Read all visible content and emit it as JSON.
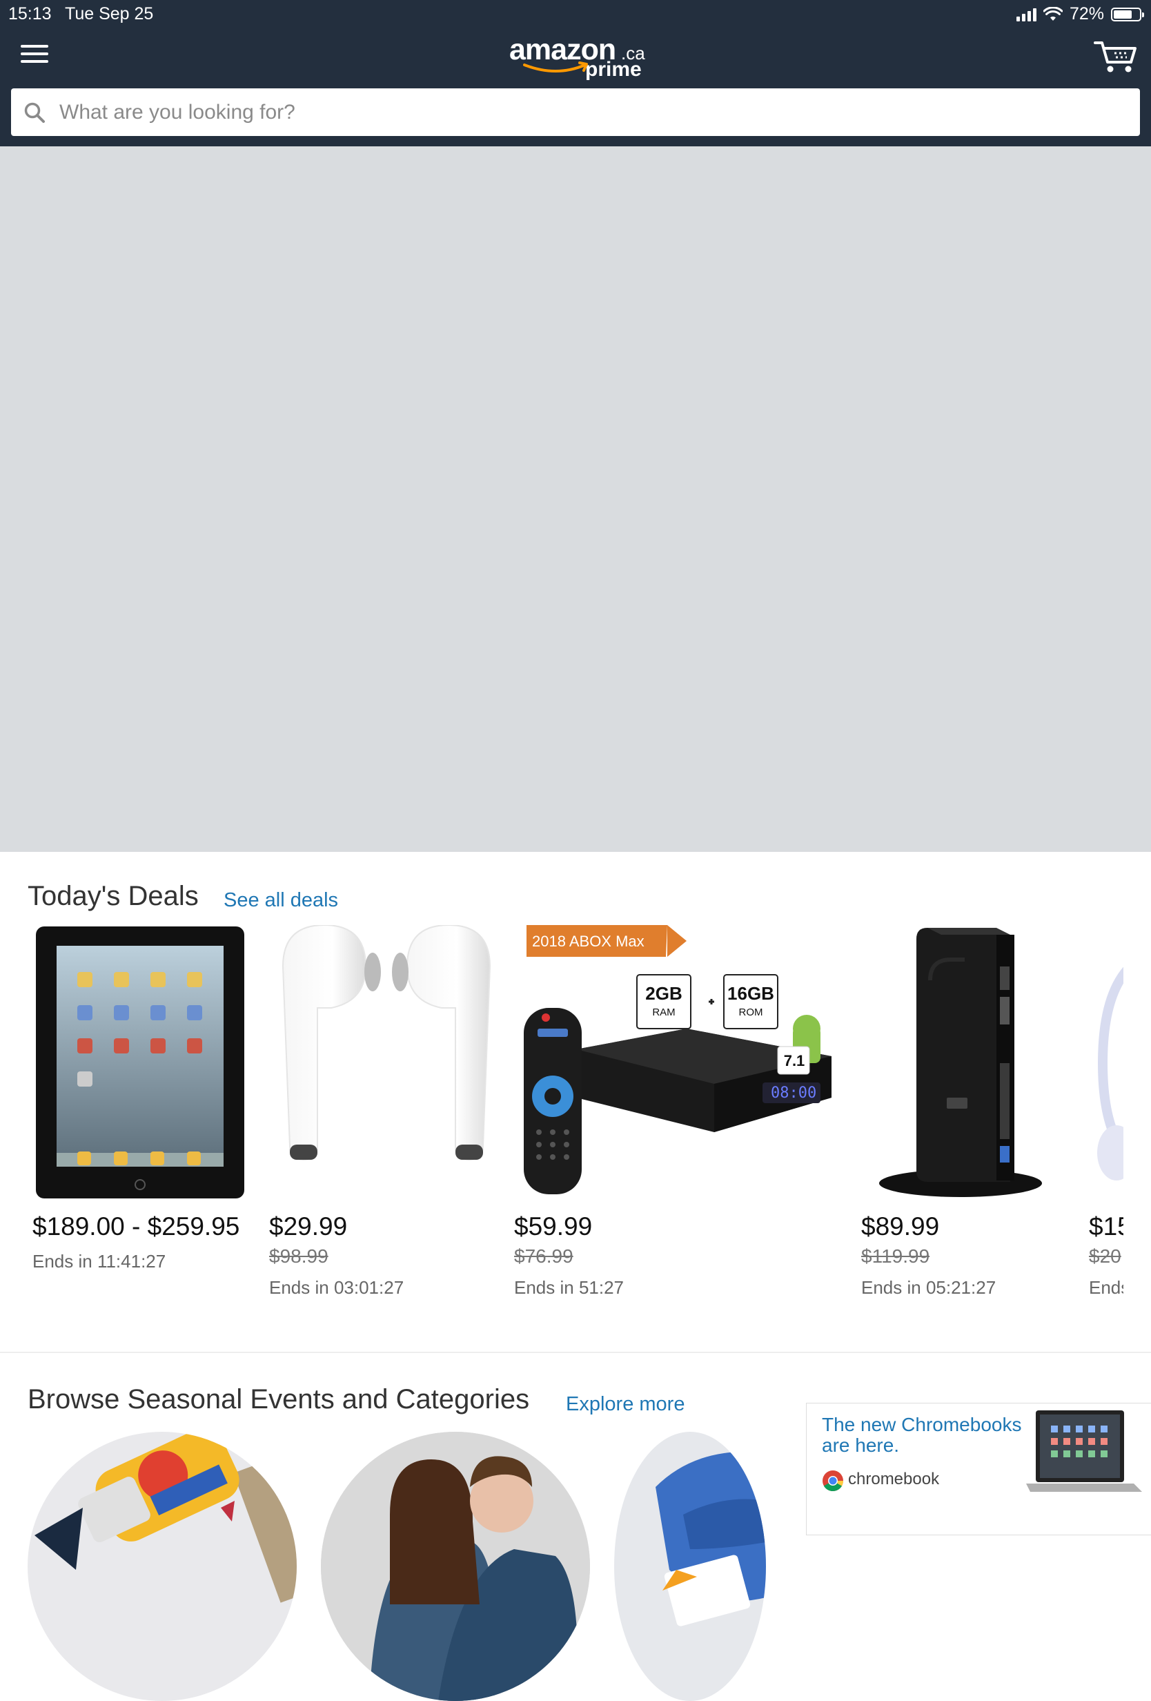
{
  "status_bar": {
    "time": "15:13",
    "date": "Tue Sep 25",
    "battery": "72%",
    "battery_level": 0.72
  },
  "header": {
    "logo_text": "amazon",
    "logo_tld": ".ca",
    "logo_sub": "prime",
    "menu_icon": "hamburger-icon",
    "cart_icon": "cart-icon"
  },
  "search": {
    "placeholder": "What are you looking for?",
    "icon": "search-icon"
  },
  "deals": {
    "title": "Today's Deals",
    "link": "See all deals",
    "items": [
      {
        "price": "$189.00 - $259.95",
        "was": "",
        "ends": "Ends in 11:41:27"
      },
      {
        "price": "$29.99",
        "was": "$98.99",
        "ends": "Ends in 03:01:27"
      },
      {
        "price": "$59.99",
        "was": "$76.99",
        "ends": "Ends in 51:27",
        "badge": "2018 ABOX Max",
        "ram": "2GB",
        "ram_label": "RAM",
        "rom": "16GB",
        "rom_label": "ROM",
        "android_version": "7.1",
        "clock": "08:00"
      },
      {
        "price": "$89.99",
        "was": "$119.99",
        "ends": "Ends in 05:21:27"
      },
      {
        "price": "$15",
        "was": "$20",
        "ends": "Ends"
      }
    ]
  },
  "browse": {
    "title": "Browse Seasonal Events and Categories",
    "link": "Explore more"
  },
  "ad": {
    "headline": "The new Chromebooks are here.",
    "brand": "chromebook"
  }
}
